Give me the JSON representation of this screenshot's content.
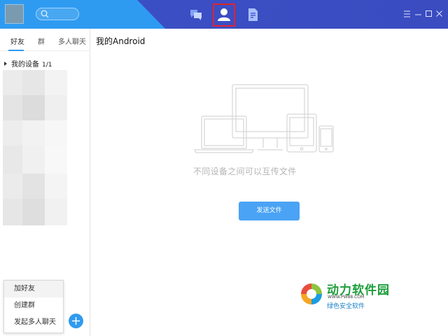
{
  "titlebar": {
    "tabs": [
      {
        "icon": "message-icon",
        "active": false
      },
      {
        "icon": "contacts-icon",
        "active": true
      },
      {
        "icon": "file-icon",
        "active": false
      }
    ],
    "window_controls": [
      "menu-icon",
      "minimize-icon",
      "maximize-icon",
      "close-icon"
    ],
    "colors": {
      "bar": "#2f9bf0",
      "bar_dark": "#3f4fc6",
      "highlight": "#e02430"
    }
  },
  "sidebar": {
    "tabs": [
      "好友",
      "群",
      "多人聊天"
    ],
    "active_tab": "好友",
    "group": {
      "label": "我的设备",
      "count": "1/1"
    }
  },
  "popup_menu": {
    "items": [
      "加好友",
      "创建群",
      "发起多人聊天"
    ]
  },
  "main": {
    "title": "我的Android",
    "caption": "不同设备之间可以互传文件",
    "send_button": "发送文件"
  },
  "watermark": {
    "name": "动力软件园",
    "url": "WWW.PW88.COM",
    "tagline": "绿色安全软件"
  }
}
